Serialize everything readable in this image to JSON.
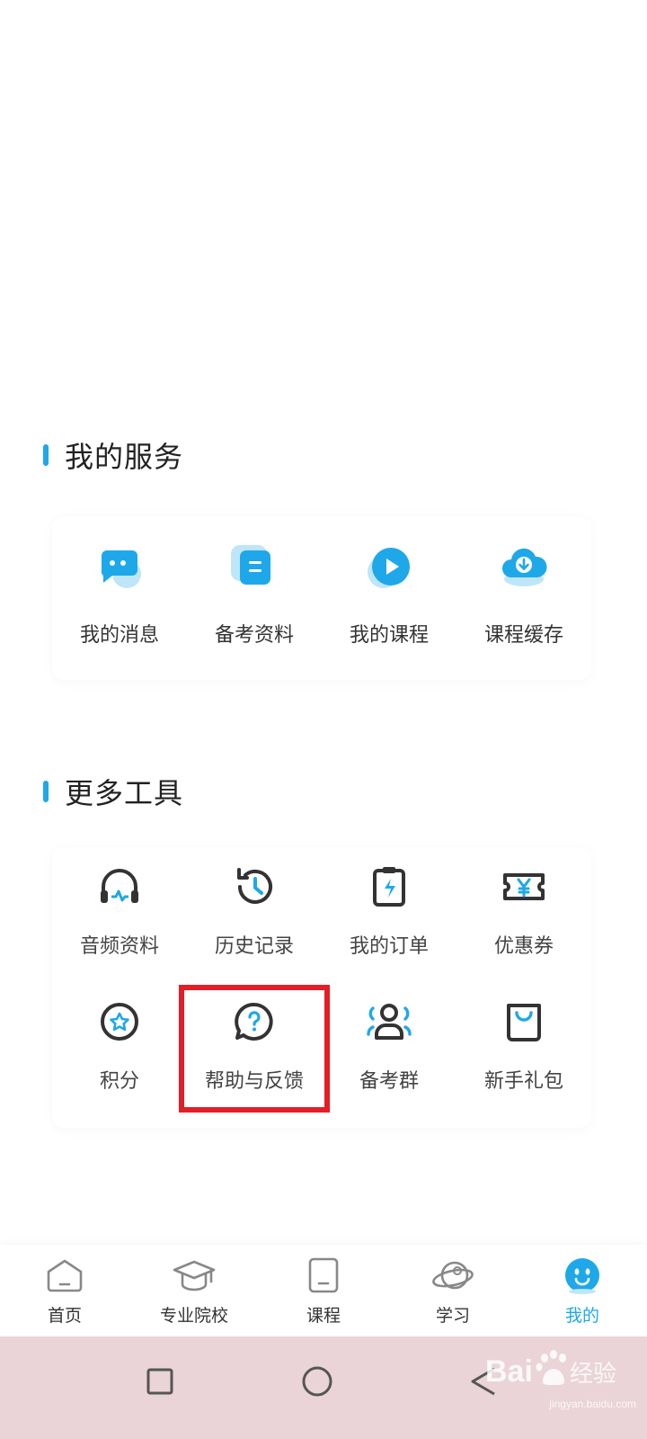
{
  "colors": {
    "accent": "#1ea8ea",
    "highlight_box": "#e41e26",
    "nav_bar_bg": "#ead4d8",
    "text": "#333333"
  },
  "services": {
    "title": "我的服务",
    "items": [
      {
        "label": "我的消息",
        "icon": "chat-bubble-icon"
      },
      {
        "label": "备考资料",
        "icon": "document-icon"
      },
      {
        "label": "我的课程",
        "icon": "play-icon"
      },
      {
        "label": "课程缓存",
        "icon": "cloud-download-icon"
      }
    ]
  },
  "tools": {
    "title": "更多工具",
    "items": [
      {
        "label": "音频资料",
        "icon": "headphones-icon"
      },
      {
        "label": "历史记录",
        "icon": "history-clock-icon"
      },
      {
        "label": "我的订单",
        "icon": "order-clipboard-icon"
      },
      {
        "label": "优惠券",
        "icon": "yen-ticket-icon"
      },
      {
        "label": "积分",
        "icon": "star-badge-icon"
      },
      {
        "label": "帮助与反馈",
        "icon": "question-bubble-icon"
      },
      {
        "label": "备考群",
        "icon": "user-group-icon"
      },
      {
        "label": "新手礼包",
        "icon": "shopping-bag-icon"
      }
    ]
  },
  "bottom_nav": {
    "items": [
      {
        "label": "首页",
        "icon": "home-icon"
      },
      {
        "label": "专业院校",
        "icon": "graduation-cap-icon"
      },
      {
        "label": "课程",
        "icon": "course-book-icon"
      },
      {
        "label": "学习",
        "icon": "planet-icon"
      },
      {
        "label": "我的",
        "icon": "smiley-avatar-icon"
      }
    ],
    "active": "我的"
  },
  "system_nav": {
    "buttons": [
      "recent-apps-icon",
      "home-circle-icon",
      "back-triangle-icon"
    ]
  },
  "watermark": {
    "text": "jingyan.baidu.com",
    "logo": "Baidu经验"
  }
}
